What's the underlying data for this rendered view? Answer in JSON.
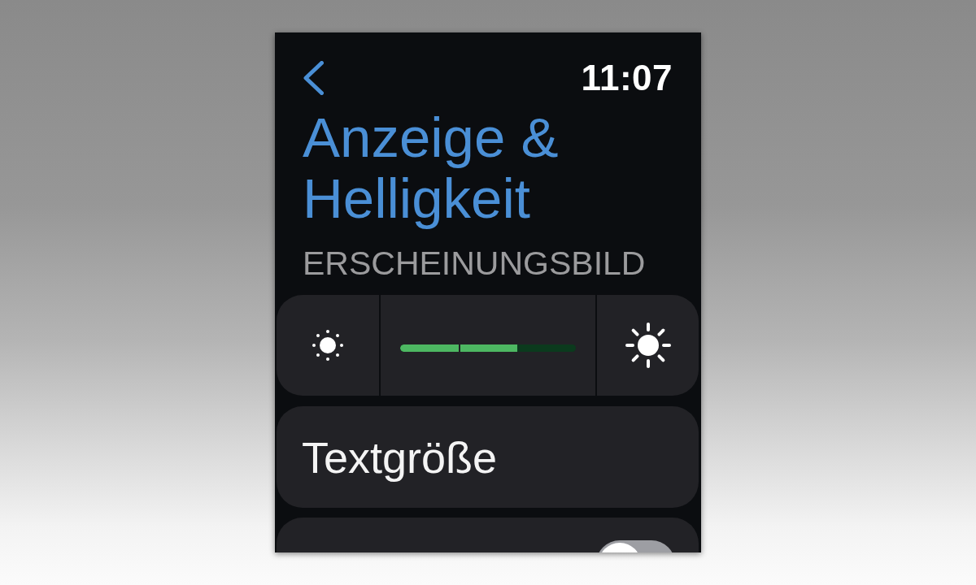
{
  "header": {
    "time": "11:07"
  },
  "title": "Anzeige & Helligkeit",
  "section_header": "ERSCHEINUNGSBILD",
  "rows": [
    {
      "kind": "brightness",
      "level": 0.667
    },
    {
      "kind": "link",
      "label": "Textgröße"
    },
    {
      "kind": "toggle",
      "on": false
    }
  ]
}
